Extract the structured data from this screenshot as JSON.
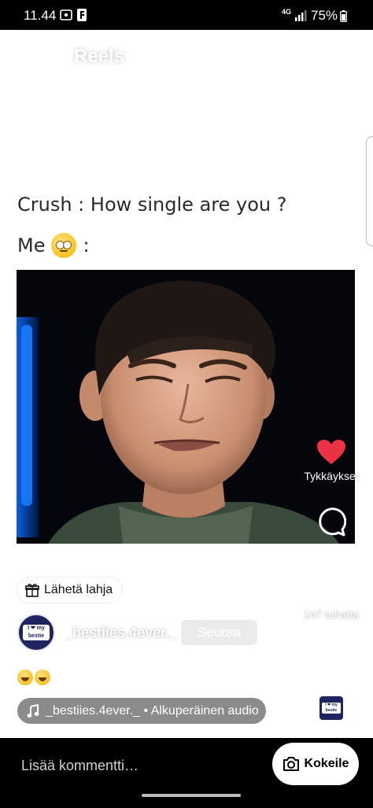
{
  "status_bar": {
    "time": "11.44",
    "network": "4G",
    "battery": "75%"
  },
  "header": {
    "title": "Reels"
  },
  "meme": {
    "line1": "Crush : How single are you ?",
    "line2": "Me",
    "line2_suffix": ":"
  },
  "overlay": {
    "gift_label": "Lähetä lahja",
    "username": "_bestiies.4ever._",
    "follow_label": "Seuraa",
    "caption_suffix": "...",
    "audio_label": "_bestiies.4ever._ • Alkuperäinen audio",
    "avatar_text": "I ❤ my bestie"
  },
  "actions": {
    "like_label": "Tykkäykset",
    "comments_label": "",
    "share_count": "147 tuhatta"
  },
  "comment_bar": {
    "placeholder": "Lisää kommentti…",
    "try_label": "Kokeile"
  },
  "colors": {
    "like": "#ed3245",
    "background": "#ffffff",
    "bar": "#000000"
  }
}
